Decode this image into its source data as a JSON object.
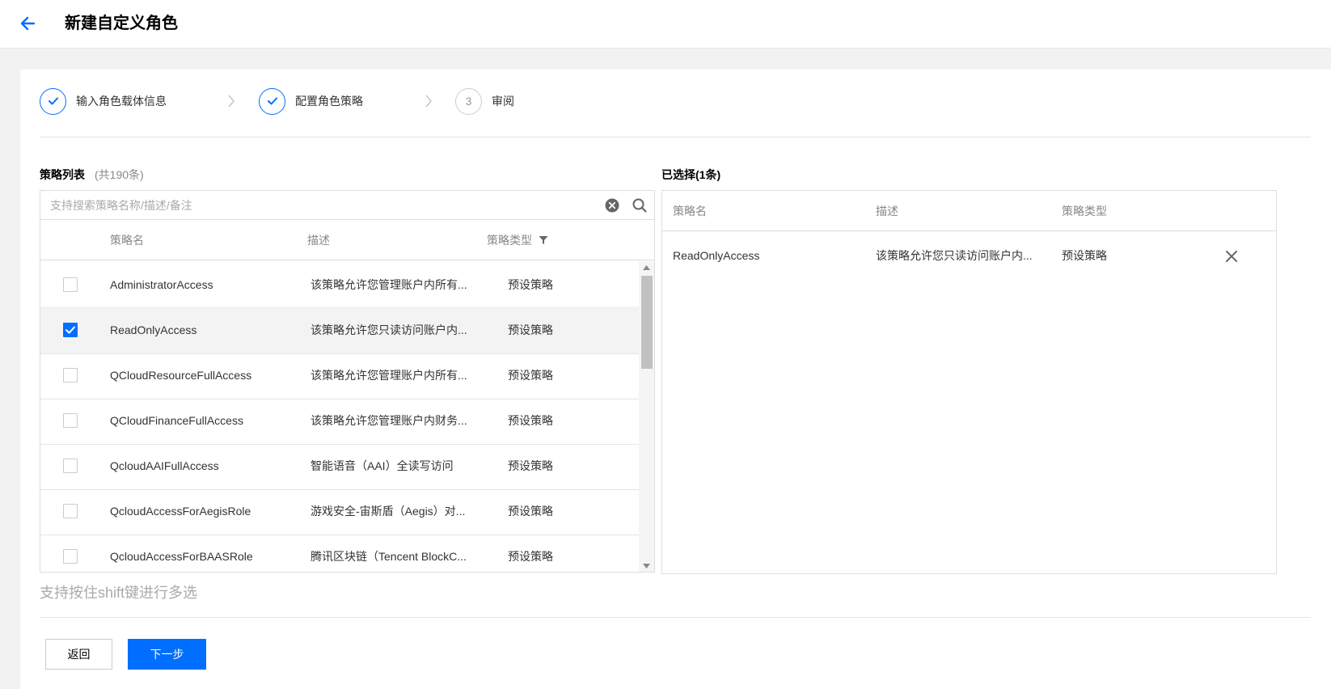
{
  "header": {
    "title": "新建自定义角色"
  },
  "steps": [
    {
      "label": "输入角色载体信息",
      "status": "done"
    },
    {
      "label": "配置角色策略",
      "status": "done"
    },
    {
      "label": "审阅",
      "status": "todo",
      "number": "3"
    }
  ],
  "policy_list": {
    "title": "策略列表",
    "count": "(共190条)",
    "search_placeholder": "支持搜索策略名称/描述/备注",
    "columns": {
      "name": "策略名",
      "desc": "描述",
      "type": "策略类型"
    },
    "rows": [
      {
        "name": "AdministratorAccess",
        "desc": "该策略允许您管理账户内所有...",
        "type": "预设策略",
        "checked": false
      },
      {
        "name": "ReadOnlyAccess",
        "desc": "该策略允许您只读访问账户内...",
        "type": "预设策略",
        "checked": true
      },
      {
        "name": "QCloudResourceFullAccess",
        "desc": "该策略允许您管理账户内所有...",
        "type": "预设策略",
        "checked": false
      },
      {
        "name": "QCloudFinanceFullAccess",
        "desc": "该策略允许您管理账户内财务...",
        "type": "预设策略",
        "checked": false
      },
      {
        "name": "QcloudAAIFullAccess",
        "desc": "智能语音（AAI）全读写访问",
        "type": "预设策略",
        "checked": false
      },
      {
        "name": "QcloudAccessForAegisRole",
        "desc": "游戏安全-宙斯盾（Aegis）对...",
        "type": "预设策略",
        "checked": false
      },
      {
        "name": "QcloudAccessForBAASRole",
        "desc": "腾讯区块链（Tencent BlockC...",
        "type": "预设策略",
        "checked": false
      }
    ]
  },
  "selected": {
    "title": "已选择(1条)",
    "columns": {
      "name": "策略名",
      "desc": "描述",
      "type": "策略类型"
    },
    "rows": [
      {
        "name": "ReadOnlyAccess",
        "desc": "该策略允许您只读访问账户内...",
        "type": "预设策略"
      }
    ]
  },
  "hint": "支持按住shift键进行多选",
  "footer": {
    "back_label": "返回",
    "next_label": "下一步"
  },
  "colors": {
    "accent": "#006eff",
    "selected_row_bg": "#f3f3f3",
    "border": "#dddddd"
  },
  "icons": {
    "back": "arrow-left-icon",
    "step_done": "check-icon",
    "step_arrow": "chevron-right-icon",
    "clear": "clear-circle-icon",
    "search": "search-icon",
    "filter": "filter-icon",
    "transfer": "double-arrow-icon",
    "remove": "close-icon"
  }
}
